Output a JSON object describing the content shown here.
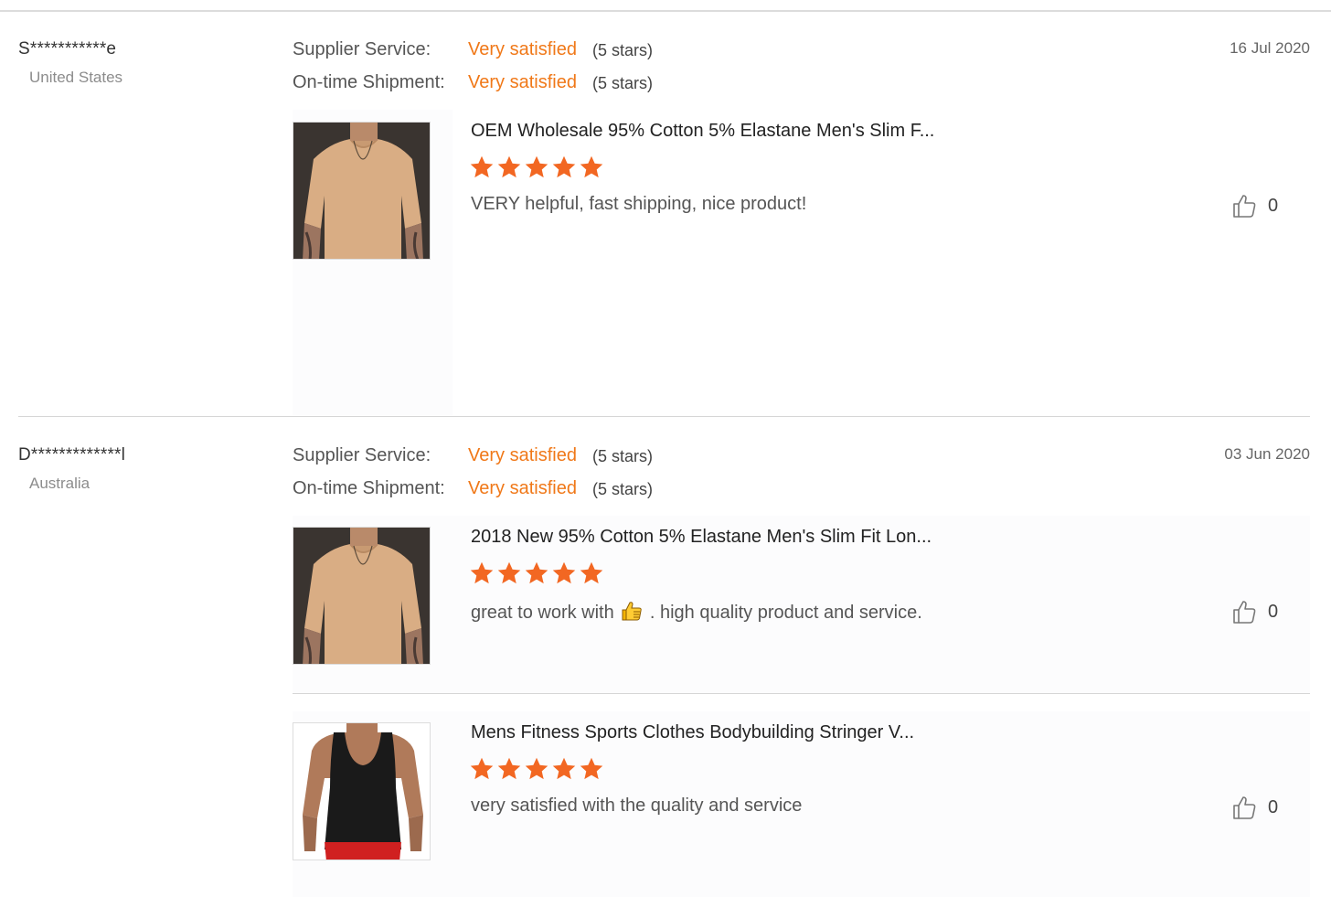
{
  "labels": {
    "supplier_service": "Supplier Service:",
    "ontime_shipment": "On-time Shipment:"
  },
  "colors": {
    "accent": "#f07818",
    "star": "#f26722"
  },
  "reviews": [
    {
      "user": "S***********e",
      "country": "United States",
      "date": "16 Jul 2020",
      "supplier_service": {
        "value": "Very satisfied",
        "stars": "(5 stars)"
      },
      "ontime_shipment": {
        "value": "Very satisfied",
        "stars": "(5 stars)"
      },
      "items": [
        {
          "title": "OEM Wholesale 95% Cotton 5% Elastane Men's Slim F...",
          "rating": 5,
          "comment": "VERY helpful, fast shipping, nice product!",
          "likes": "0",
          "image": "tan-tshirt"
        }
      ]
    },
    {
      "user": "D*************l",
      "country": "Australia",
      "date": "03 Jun 2020",
      "supplier_service": {
        "value": "Very satisfied",
        "stars": "(5 stars)"
      },
      "ontime_shipment": {
        "value": "Very satisfied",
        "stars": "(5 stars)"
      },
      "items": [
        {
          "title": "2018 New 95% Cotton 5% Elastane Men's Slim Fit Lon...",
          "rating": 5,
          "comment_part1": "great to work with",
          "comment_emoji": "thumbs-up-emoji",
          "comment_part2": ". high quality product and service.",
          "likes": "0",
          "image": "tan-tshirt"
        },
        {
          "title": "Mens Fitness Sports Clothes Bodybuilding Stringer V...",
          "rating": 5,
          "comment": "very satisfied with the quality and service",
          "likes": "0",
          "image": "black-tank-top"
        }
      ]
    }
  ]
}
